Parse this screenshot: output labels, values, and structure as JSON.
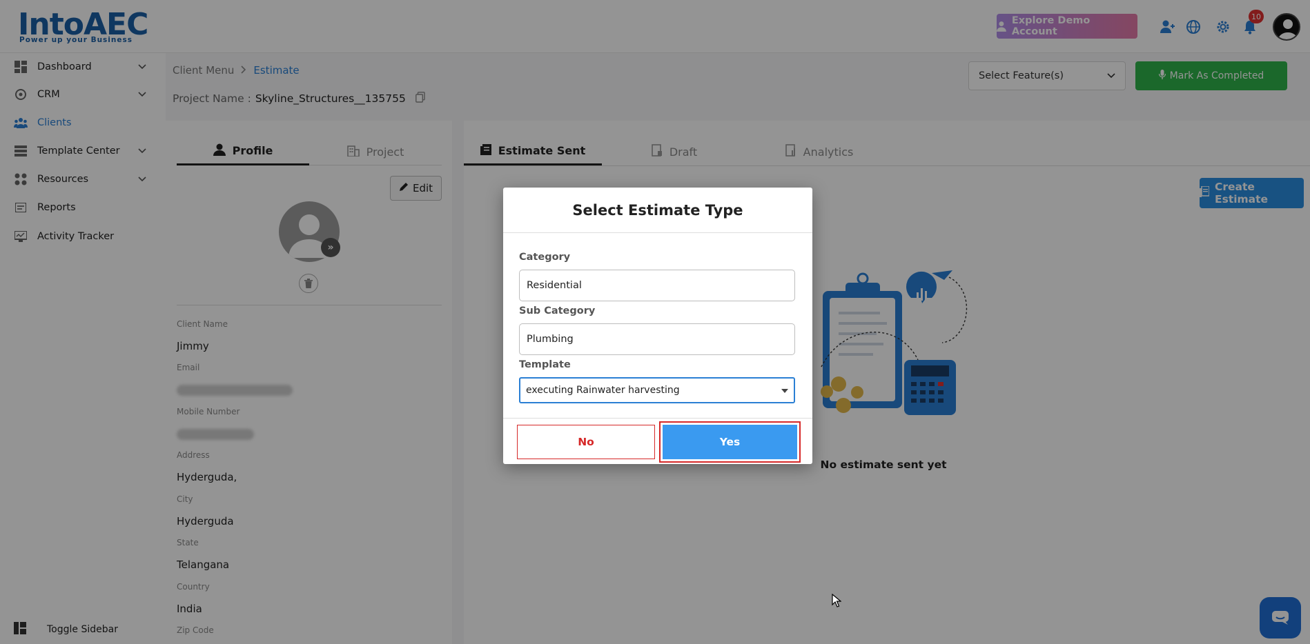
{
  "header": {
    "logo_text": "IntoAEC",
    "logo_tagline": "Power up your Business",
    "demo_button": "Explore Demo Account",
    "notification_count": "10",
    "icons": [
      "add-user-icon",
      "globe-icon",
      "gear-icon",
      "bell-icon",
      "user-avatar"
    ]
  },
  "sidebar": {
    "items": [
      {
        "label": "Dashboard",
        "icon": "dashboard-icon"
      },
      {
        "label": "CRM",
        "icon": "crm-icon"
      },
      {
        "label": "Clients",
        "icon": "clients-icon"
      },
      {
        "label": "Template Center",
        "icon": "template-icon"
      },
      {
        "label": "Resources",
        "icon": "resources-icon"
      },
      {
        "label": "Reports",
        "icon": "reports-icon"
      },
      {
        "label": "Activity Tracker",
        "icon": "activity-icon"
      }
    ],
    "toggle_label": "Toggle Sidebar"
  },
  "breadcrumb": {
    "parent": "Client Menu",
    "current": "Estimate"
  },
  "project": {
    "label": "Project Name :",
    "value": "Skyline_Structures__135755"
  },
  "toolbar": {
    "select_feature": "Select Feature(s)",
    "mark_completed": "Mark As Completed"
  },
  "profile_tabs": {
    "profile": "Profile",
    "project": "Project"
  },
  "profile": {
    "edit_label": "Edit",
    "fields": {
      "client_name_label": "Client Name",
      "client_name": "Jimmy",
      "email_label": "Email",
      "mobile_label": "Mobile Number",
      "address_label": "Address",
      "address": "Hyderguda,",
      "city_label": "City",
      "city": "Hyderguda",
      "state_label": "State",
      "state": "Telangana",
      "country_label": "Country",
      "country": "India",
      "zip_label": "Zip Code"
    }
  },
  "estimate_tabs": {
    "sent": "Estimate Sent",
    "draft": "Draft",
    "analytics": "Analytics"
  },
  "estimate": {
    "create_label": "Create Estimate",
    "empty_text": "No estimate sent yet"
  },
  "modal": {
    "title": "Select Estimate Type",
    "category_label": "Category",
    "category_value": "Residential",
    "subcategory_label": "Sub Category",
    "subcategory_value": "Plumbing",
    "template_label": "Template",
    "template_value": "executing Rainwater harvesting",
    "no_label": "No",
    "yes_label": "Yes"
  },
  "colors": {
    "accent": "#2a7fd4",
    "success": "#2fb34a",
    "danger": "#d62828",
    "primary_button": "#3a9af0"
  }
}
